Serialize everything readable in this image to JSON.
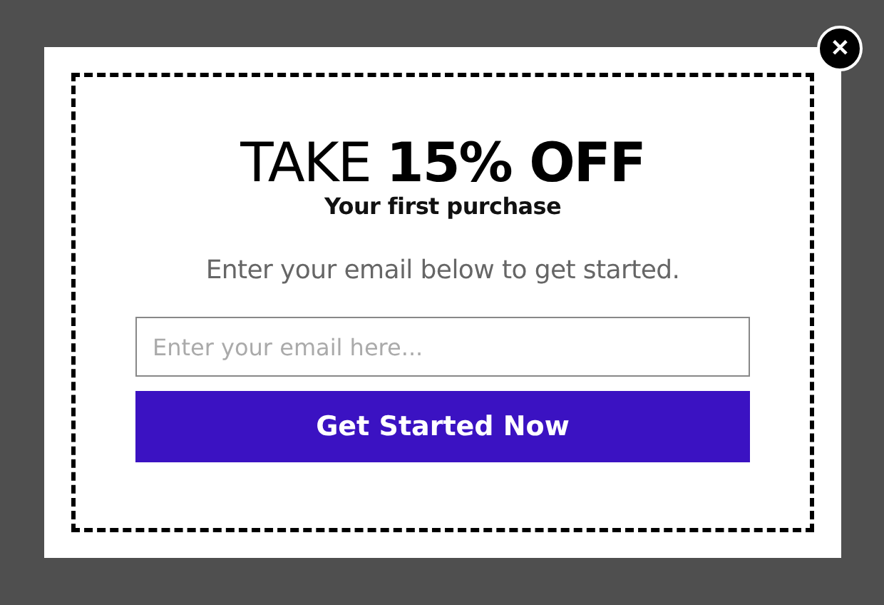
{
  "popup": {
    "title": "TAKE **15% OFF**",
    "subtitle": "Your first purchase",
    "prompt": "Enter your email below to get started.",
    "email_field": {
      "placeholder": "Enter your email here..."
    },
    "submit_button": "Get Started Now",
    "close_symbol": "✕"
  }
}
